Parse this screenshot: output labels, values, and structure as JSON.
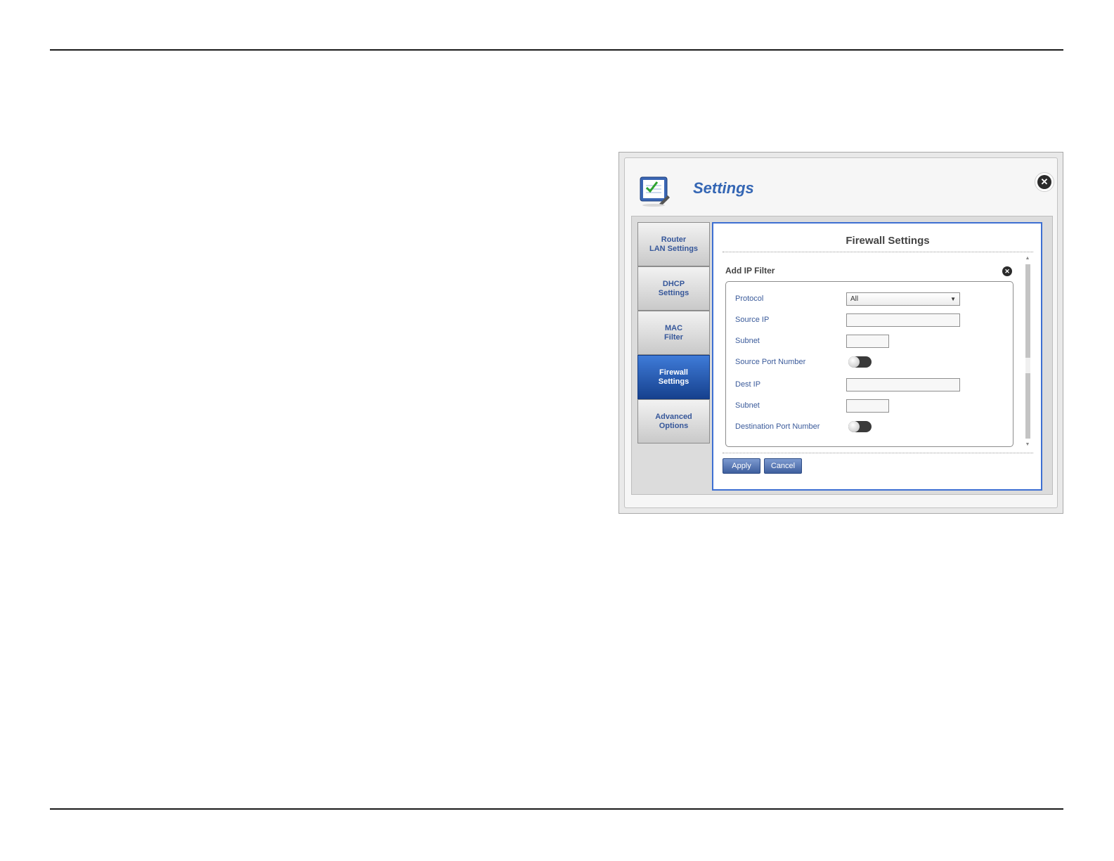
{
  "window": {
    "title": "Settings",
    "close_icon": "close-icon",
    "header_icon": "settings-checklist-icon"
  },
  "tabs": [
    {
      "line1": "Router",
      "line2": "LAN Settings",
      "active": false
    },
    {
      "line1": "DHCP",
      "line2": "Settings",
      "active": false
    },
    {
      "line1": "MAC",
      "line2": "Filter",
      "active": false
    },
    {
      "line1": "Firewall",
      "line2": "Settings",
      "active": true
    },
    {
      "line1": "Advanced",
      "line2": "Options",
      "active": false
    }
  ],
  "panel": {
    "title": "Firewall Settings",
    "section_title": "Add IP Filter",
    "fields": {
      "protocol_label": "Protocol",
      "protocol_value": "All",
      "source_ip_label": "Source IP",
      "source_ip_value": "",
      "subnet1_label": "Subnet",
      "subnet1_value": "",
      "source_port_label": "Source Port Number",
      "dest_ip_label": "Dest IP",
      "dest_ip_value": "",
      "subnet2_label": "Subnet",
      "subnet2_value": "",
      "dest_port_label": "Destination Port Number"
    },
    "buttons": {
      "apply": "Apply",
      "cancel": "Cancel"
    }
  }
}
